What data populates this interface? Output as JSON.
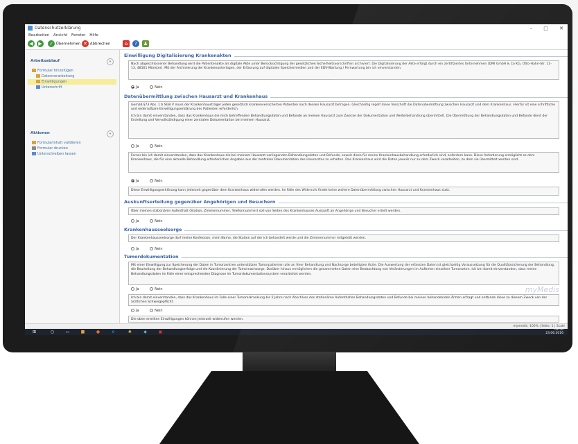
{
  "window": {
    "title": "Datenschutzerklärung",
    "controls": [
      "–",
      "□",
      "✕"
    ]
  },
  "menu": [
    "Bearbeiten",
    "Ansicht",
    "Fenster",
    "Hilfe"
  ],
  "toolbar": {
    "accept_label": "Übernehmen",
    "cancel_label": "Abbrechen"
  },
  "sidebar": {
    "workflow": {
      "title": "Arbeitsablauf",
      "items": [
        "Formular hinzufügen",
        "Datenverarbeitung",
        "Einwilligungen",
        "Unterschrift"
      ]
    },
    "actions": {
      "title": "Aktionen",
      "items": [
        "Formularinhalt validieren",
        "Formular drucken",
        "Unterschreiben lassen"
      ]
    }
  },
  "sections": {
    "s1_title": "Einwilligung Digitalisierung Krankenakten",
    "s1_text": "Nach abgeschlossener Behandlung wird die Patientenakte als digitale Akte unter Berücksichtigung der gesetzlichen Sicherheitsvorschriften archiviert. Die Digitalisierung der Akte erfolgt durch ein zertifiziertes Unternehmen (DMI GmbH & Co KG, Otto-Hahn-Str. 11-13, 48161 Münster). Mit der Archivierung der Krankenunterlagen, der Erfassung auf digitalen Speichermedien und der EDV-Wartung / Fernwartung bin ich einverstanden.",
    "s2_title": "Datenübermittlung zwischen Hausarzt und Krankenhaus",
    "s2_text_a": "Gemäß §73 Abs. 1 b SGB V muss der Krankenhausträger jeden gesetzlich krankenversicherten Patienten nach dessen Hausarzt befragen. Gleichzeitig regelt diese Vorschrift die Datenübermittlung zwischen Hausarzt und dem Krankenhaus. Hierfür ist eine schriftliche und widerrufbare Einwilligungserklärung des Patienten erforderlich.",
    "s2_text_b": "Ich bin damit einverstanden, dass das Krankenhaus die mich betreffenden Behandlungsdaten und Befunde an meinen Hausarzt zum Zwecke der Dokumentation und Weiterbehandlung übermittelt. Die Übermittlung der Behandlungsdaten und Befunde dient der Erstellung und Vervollständigung einer zentralen Dokumentation bei meinem Hausarzt.",
    "s2_text_c": "Ferner bin ich damit einverstanden, dass das Krankenhaus die bei meinem Hausarzt vorliegenden Behandlungsdaten und Befunde, soweit diese für meine Krankenhausbehandlung erforderlich sind, anfordern kann. Diese Anforderung ermöglicht es dem Krankenhaus, die für eine aktuelle Behandlung erforderlichen Angaben aus der zentralen Dokumentation des Hausarztes zu erhalten. Das Krankenhaus wird die Daten jeweils nur zu dem Zweck verarbeiten, zu dem sie übermittelt worden sind.",
    "s2_text_d": "Diese Einwilligungserklärung kann jederzeit gegenüber dem Krankenhaus widerrufen werden. Im Falle des Widerrufs findet keine weitere Datenübermittlung zwischen Hausarzt und Krankenhaus statt.",
    "s3_title": "Auskunftserteilung gegenüber Angehörigen und Besuchern",
    "s3_text": "Über meinen stationären Aufenthalt (Station, Zimmernummer, Telefonnummer) soll von Seiten des Krankenhauses Auskunft an Angehörige und Besucher erteilt werden.",
    "s4_title": "Krankenhausseelsorge",
    "s4_text": "Der Krankenhausseelsorge darf meine Konfession, mein Name, die Station auf der ich behandelt werde und die Zimmernummer mitgeteilt werden.",
    "s5_title": "Tumordokumentation",
    "s5_text_a": "Mit einer Einwilligung zur Speicherung der Daten in Tumorzentren unterstützen Tumorpatienten alle an Ihrer Behandlung und Nachsorge beteiligten Ärzte. Die Auswertung der erfassten Daten ist gleichzeitig Voraussetzung für die Qualitätssicherung der Behandlung, die Beurteilung der Behandlungserfolge und die Koordinierung der Tumornachsorge. Darüber hinaus ermöglichen die gesammelten Daten eine Beobachtung von Veränderungen im Auftreten einzelner Tumorarten. Ich bin damit einverstanden, dass meine Behandlungsdaten im Falle einer entsprechenden Diagnose im Tumordokumentationssystem verarbeitet werden.",
    "s5_text_b": "Ich bin damit einverstanden, dass das Krankenhaus im Falle einer Tumorerkrankung bis 5 Jahre nach Abschluss des stationären Aufenthaltes Behandlungsdaten und Befunde bei meinen behandelnden Ärzten erfragt und entbinde diese zu diesem Zweck von der ärztlichen Schweigepflicht.",
    "s5_text_c": "Die oben erteilten Einwilligungen können jederzeit widerrufen werden."
  },
  "radio": {
    "yes": "Ja",
    "no": "Nein"
  },
  "brand": "myMedis",
  "statusbar": {
    "user": "mymedis: 100%",
    "page": "Seite: 1",
    "zoom": "Scale"
  },
  "tray": {
    "time": "09:56",
    "date": "23.06.2016"
  }
}
